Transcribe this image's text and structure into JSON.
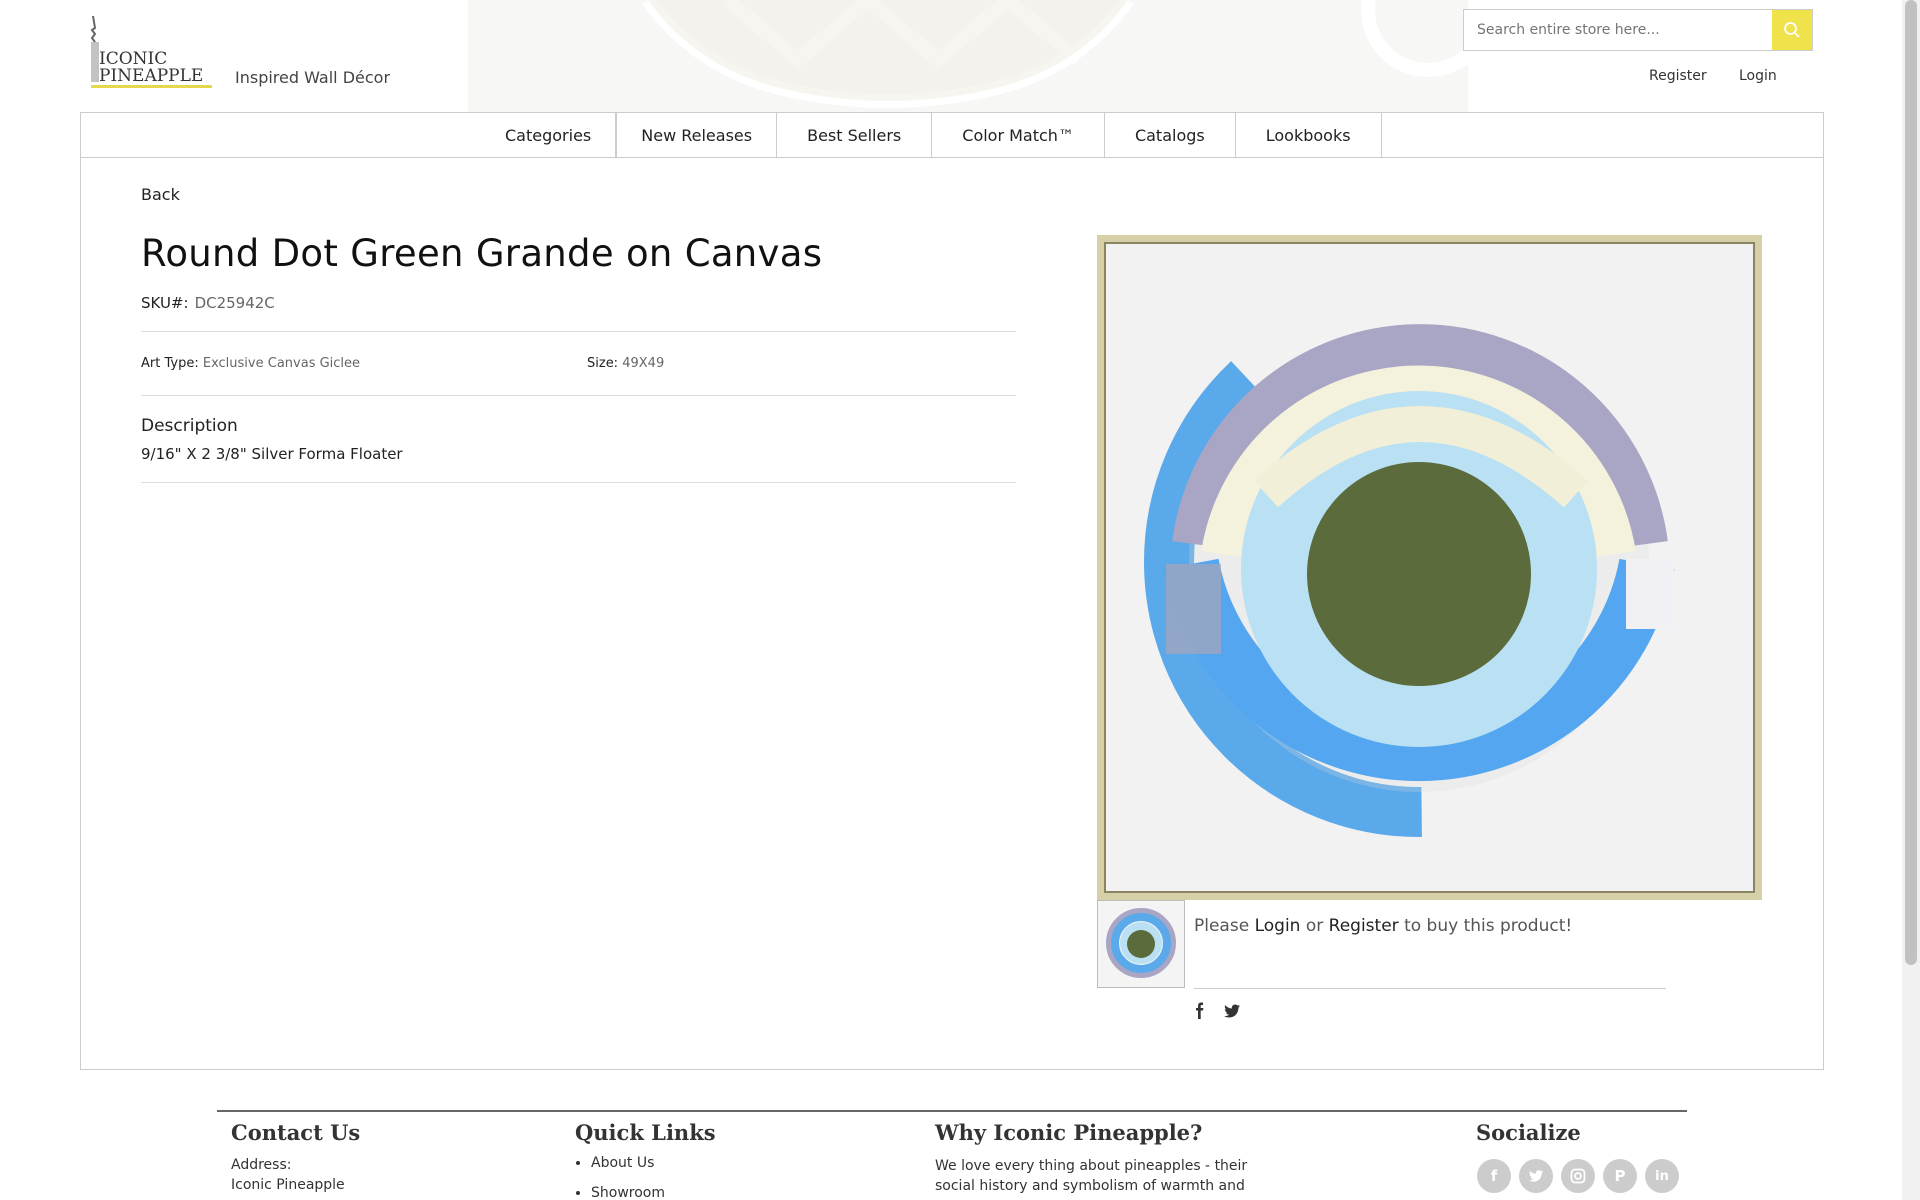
{
  "brand": {
    "logo_line1": "ICONIC",
    "logo_line2": "PINEAPPLE",
    "tagline": "Inspired Wall Décor",
    "accent_color": "#f0e24a"
  },
  "search": {
    "placeholder": "Search entire store here..."
  },
  "account": {
    "register": "Register",
    "login": "Login"
  },
  "nav": {
    "items": [
      "Categories",
      "New Releases",
      "Best Sellers",
      "Color Match™",
      "Catalogs",
      "Lookbooks"
    ]
  },
  "product": {
    "back_label": "Back",
    "title": "Round Dot Green Grande on Canvas",
    "sku_label": "SKU#:",
    "sku": "DC25942C",
    "art_type_label": "Art Type:",
    "art_type": "Exclusive Canvas Giclee",
    "size_label": "Size:",
    "size": "49X49",
    "description_heading": "Description",
    "description": "9/16\" X 2 3/8\" Silver Forma Floater"
  },
  "purchase": {
    "prefix": "Please",
    "login": "Login",
    "or": "or",
    "register": "Register",
    "suffix": "to buy this product!"
  },
  "share": {
    "icons": [
      "facebook-icon",
      "twitter-icon"
    ]
  },
  "footer": {
    "contact_heading": "Contact Us",
    "address_label": "Address:",
    "address_line1": "Iconic Pineapple",
    "quicklinks_heading": "Quick Links",
    "quicklinks": [
      "About Us",
      "Showroom"
    ],
    "why_heading": "Why Iconic Pineapple?",
    "why_text_line1": "We love every thing about pineapples - their",
    "why_text_line2": "social history and symbolism of warmth and",
    "socialize_heading": "Socialize",
    "social_icons": [
      "facebook-icon",
      "twitter-icon",
      "instagram-icon",
      "pinterest-icon",
      "linkedin-icon"
    ]
  }
}
